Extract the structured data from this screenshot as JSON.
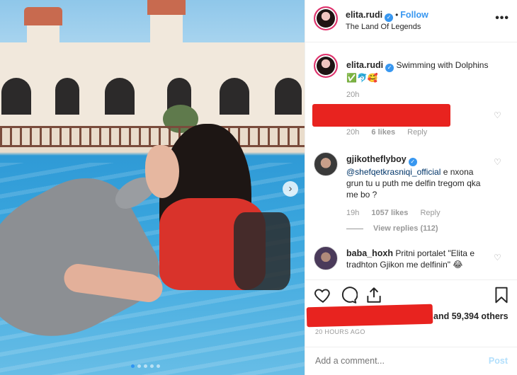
{
  "post": {
    "author": "elita.rudi",
    "follow_label": "Follow",
    "location": "The Land Of Legends",
    "more_label": "•••",
    "caption": "Swimming with Dolphins",
    "caption_emojis": "✅🐬🥰",
    "caption_time": "20h"
  },
  "comments": [
    {
      "username": "",
      "text": "",
      "time": "20h",
      "likes": "6 likes",
      "reply_label": "Reply"
    },
    {
      "username": "gjikotheflyboy",
      "mention": "@shefqetkrasniqi_official",
      "text": " e nxona grun tu u puth me delfin tregom qka me bo ?",
      "time": "19h",
      "likes": "1057 likes",
      "reply_label": "Reply",
      "view_replies": "View replies (112)"
    },
    {
      "username": "baba_hoxh",
      "text": "Pritni portalet \"Elita e tradhton Gjikon me delfinin\" 😂"
    }
  ],
  "likes_summary": "and 59,394 others",
  "timestamp": "20 HOURS AGO",
  "add_comment_placeholder": "Add a comment...",
  "post_button": "Post",
  "colors": {
    "link_blue": "#3897f0",
    "mention_blue": "#003569",
    "redaction_red": "#e8231f",
    "border": "#efefef"
  }
}
